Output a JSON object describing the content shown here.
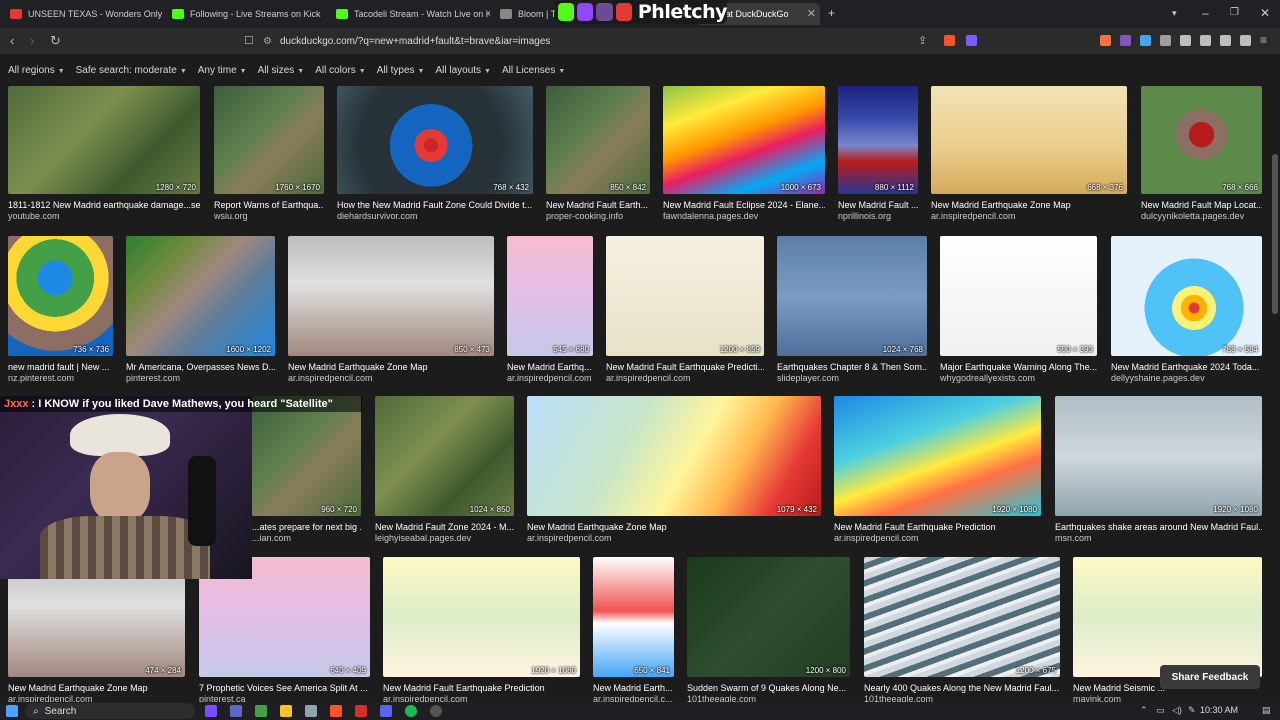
{
  "tabs": [
    {
      "title": "UNSEEN TEXAS - Wonders Only Loca",
      "color": "#e53935"
    },
    {
      "title": "Following - Live Streams on Kick",
      "color": "#53fc18"
    },
    {
      "title": "Tacodeli Stream - Watch Live on Kick",
      "color": "#53fc18"
    },
    {
      "title": "Bloom | To",
      "color": "#888888"
    },
    {
      "title": "fault at DuckDuckGo",
      "color": "#de5833"
    }
  ],
  "overlay": {
    "name": "Phletchy"
  },
  "url": "duckduckgo.com/?q=new+madrid+fault&t=brave&iar=images",
  "filters": [
    "All regions",
    "Safe search: moderate",
    "Any time",
    "All sizes",
    "All colors",
    "All types",
    "All layouts",
    "All Licenses"
  ],
  "results": [
    {
      "title": "1811-1812 New Madrid earthquake damage...se...",
      "source": "youtube.com",
      "dims": "1280 × 720",
      "style": "map-green"
    },
    {
      "title": "Report Warns of Earthqua...",
      "source": "wsiu.org",
      "dims": "1760 × 1670",
      "style": "map-sat"
    },
    {
      "title": "How the New Madrid Fault Zone Could Divide t...",
      "source": "diehardsurvivor.com",
      "dims": "768 × 432",
      "style": "map-red"
    },
    {
      "title": "New Madrid Fault Earth...",
      "source": "proper-cooking.info",
      "dims": "850 × 842",
      "style": "map-sat"
    },
    {
      "title": "New Madrid Fault Eclipse 2024 - Elane...",
      "source": "fawndalenna.pages.dev",
      "dims": "1000 × 673",
      "style": "map-usa"
    },
    {
      "title": "New Madrid Fault ...",
      "source": "nprillinois.org",
      "dims": "880 × 1112",
      "style": "map-blue"
    },
    {
      "title": "New Madrid Earthquake Zone Map",
      "source": "ar.inspiredpencil.com",
      "dims": "668 × 376",
      "style": "map-tan"
    },
    {
      "title": "New Madrid Fault Map Locat...",
      "source": "dulcyynikoletta.pages.dev",
      "dims": "768 × 666",
      "style": "map-redblob"
    },
    {
      "title": "new madrid fault | New ...",
      "source": "nz.pinterest.com",
      "dims": "736 × 736",
      "style": "map-lakes"
    },
    {
      "title": "Mr Americana, Overpasses News D...",
      "source": "pinterest.com",
      "dims": "1600 × 1202",
      "style": "map-relief"
    },
    {
      "title": "New Madrid Earthquake Zone Map",
      "source": "ar.inspiredpencil.com",
      "dims": "850 × 473",
      "style": "map-multi"
    },
    {
      "title": "New Madrid Earthq...",
      "source": "ar.inspiredpencil.com",
      "dims": "545 × 680",
      "style": "map-pink"
    },
    {
      "title": "New Madrid Fault Earthquake Predicti...",
      "source": "ar.inspiredpencil.com",
      "dims": "1200 × 859",
      "style": "map-pale"
    },
    {
      "title": "Earthquakes Chapter 8 & Then Som...",
      "source": "slideplayer.com",
      "dims": "1024 × 768",
      "style": "map-blueriver"
    },
    {
      "title": "Major Earthquake Warning Along The...",
      "source": "whygodreallyexists.com",
      "dims": "550 × 393",
      "style": "map-white"
    },
    {
      "title": "New Madrid Earthquake 2024 Toda...",
      "source": "dellyyshaine.pages.dev",
      "dims": "788 × 584",
      "style": "map-hazard"
    },
    {
      "title": "...ates prepare for next big ...",
      "source": "...ian.com",
      "dims": "960 × 720",
      "style": "map-sat"
    },
    {
      "title": "New Madrid Fault Zone 2024 - M...",
      "source": "leighyiseabal.pages.dev",
      "dims": "1024 × 850",
      "style": "map-green"
    },
    {
      "title": "New Madrid Earthquake Zone Map",
      "source": "ar.inspiredpencil.com",
      "dims": "1079 × 432",
      "style": "map-arkansas"
    },
    {
      "title": "New Madrid Fault Earthquake Prediction",
      "source": "ar.inspiredpencil.com",
      "dims": "1920 × 1080",
      "style": "map-news"
    },
    {
      "title": "Earthquakes shake areas around New Madrid Faul...",
      "source": "msn.com",
      "dims": "1920 × 1080",
      "style": "map-gray"
    },
    {
      "title": "New Madrid Earthquake Zone Map",
      "source": "ar.inspiredpencil.com",
      "dims": "474 × 284",
      "style": "map-multi"
    },
    {
      "title": "7 Prophetic Voices See America Split At ...",
      "source": "pinterest.ca",
      "dims": "640 × 409",
      "style": "map-pink"
    },
    {
      "title": "New Madrid Fault Earthquake Prediction",
      "source": "ar.inspiredpencil.com",
      "dims": "1920 × 1080",
      "style": "map-yellowpale"
    },
    {
      "title": "New Madrid Earth...",
      "source": "ar.inspiredpencil.c...",
      "dims": "650 × 841",
      "style": "map-wave"
    },
    {
      "title": "Sudden Swarm of 9 Quakes Along Ne...",
      "source": "101theeagle.com",
      "dims": "1200 × 800",
      "style": "map-dark"
    },
    {
      "title": "Nearly 400 Quakes Along the New Madrid Faul...",
      "source": "101theeagle.com",
      "dims": "1200 × 675",
      "style": "map-rock"
    },
    {
      "title": "New Madrid Seismic ...",
      "source": "mavink.com",
      "dims": "",
      "style": "map-yellowpale"
    }
  ],
  "chat": {
    "user": "Jxxx",
    "message": ": I KNOW if you liked Dave Mathews, you heard \"Satellite\""
  },
  "share_feedback": "Share Feedback",
  "taskbar": {
    "search": "Search",
    "clock": "10:30 AM"
  }
}
